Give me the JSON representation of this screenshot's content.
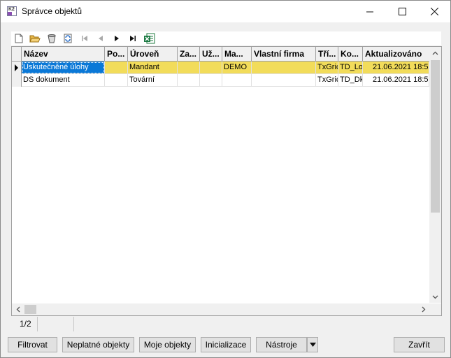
{
  "window": {
    "title": "Správce objektů",
    "app_icon_text": "K2"
  },
  "controls": {
    "minimize": "—",
    "maximize": "☐",
    "close": "✕"
  },
  "toolbar": {
    "icons": [
      "new-document-icon",
      "open-folder-icon",
      "bucket-icon",
      "refresh-icon",
      "first-record-icon",
      "previous-record-icon",
      "next-record-icon",
      "last-record-icon",
      "excel-export-icon"
    ]
  },
  "grid": {
    "columns": [
      "Název",
      "Po...",
      "Úroveň",
      "Za...",
      "Už...",
      "Ma...",
      "Vlastní firma",
      "Tří...",
      "Ko...",
      "Aktualizováno"
    ],
    "rows": [
      {
        "cells": [
          "Uskutečněné úlohy",
          "",
          "Mandant",
          "",
          "",
          "DEMO",
          "",
          "TxGric",
          "TD_Lo",
          "21.06.2021 18:5"
        ],
        "selected": true
      },
      {
        "cells": [
          "DS dokument",
          "",
          "Tovární",
          "",
          "",
          "",
          "",
          "TxGric",
          "TD_Dk",
          "21.06.2021 18:5"
        ],
        "selected": false
      }
    ]
  },
  "status": {
    "record_position": "1/2"
  },
  "buttons": {
    "filter": "Filtrovat",
    "invalid_objects": "Neplatné objekty",
    "my_objects": "Moje objekty",
    "initialize": "Inicializace",
    "tools": "Nástroje",
    "close": "Zavřít"
  }
}
